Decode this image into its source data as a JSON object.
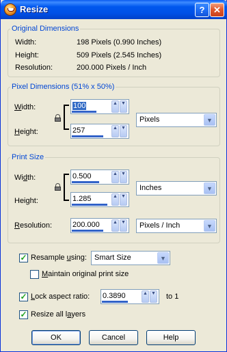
{
  "window": {
    "title": "Resize",
    "help_button": "?",
    "close_button": "✕"
  },
  "original_dimensions": {
    "legend": "Original Dimensions",
    "width_label": "Width:",
    "width_value": "198 Pixels (0.990 Inches)",
    "height_label": "Height:",
    "height_value": "509 Pixels (2.545 Inches)",
    "resolution_label": "Resolution:",
    "resolution_value": "200.000 Pixels / Inch"
  },
  "pixel_dimensions": {
    "legend": "Pixel Dimensions (51% x 50%)",
    "width_label": "Width:",
    "width_value": "100",
    "height_label": "Height:",
    "height_value": "257",
    "unit": "Pixels"
  },
  "print_size": {
    "legend": "Print Size",
    "width_label": "Width:",
    "width_value": "0.500",
    "height_label": "Height:",
    "height_value": "1.285",
    "unit": "Inches",
    "resolution_label": "Resolution:",
    "resolution_value": "200.000",
    "resolution_unit": "Pixels / Inch"
  },
  "options": {
    "resample_label": "Resample using:",
    "resample_checked": true,
    "resample_method": "Smart Size",
    "maintain_label": "Maintain original print size",
    "maintain_checked": false,
    "lock_aspect_label": "Lock aspect ratio:",
    "lock_aspect_checked": true,
    "aspect_value": "0.3890",
    "aspect_suffix": "to 1",
    "resize_layers_label": "Resize all layers",
    "resize_layers_checked": true
  },
  "buttons": {
    "ok": "OK",
    "cancel": "Cancel",
    "help": "Help"
  },
  "icons": [
    "paint-shop-app-icon",
    "help-icon",
    "close-icon",
    "lock-icon",
    "spin-up-icon",
    "spin-down-icon",
    "dropdown-arrow-icon",
    "checkmark-icon"
  ]
}
